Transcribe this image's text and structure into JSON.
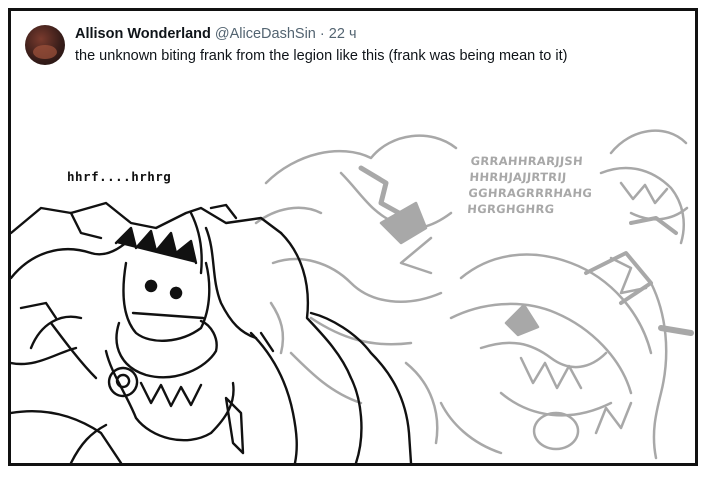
{
  "tweet": {
    "display_name": "Allison Wonderland",
    "handle": "@AliceDashSin",
    "separator": "·",
    "time": "22 ч",
    "text": "the unknown biting frank from the legion like this (frank was being mean to it)"
  },
  "comic": {
    "whisper_text": "hhrf....hrhrg",
    "roar_lines": [
      "GRRAHHRARJJSH",
      "HHRHJAJJRTRIJ",
      "GGHRAGRRRHAHG",
      "HGRGHGHRG"
    ]
  },
  "colors": {
    "text": "#0f1419",
    "muted": "#536471",
    "line_art": "#111111",
    "ghost_art": "#a8a8a8"
  }
}
